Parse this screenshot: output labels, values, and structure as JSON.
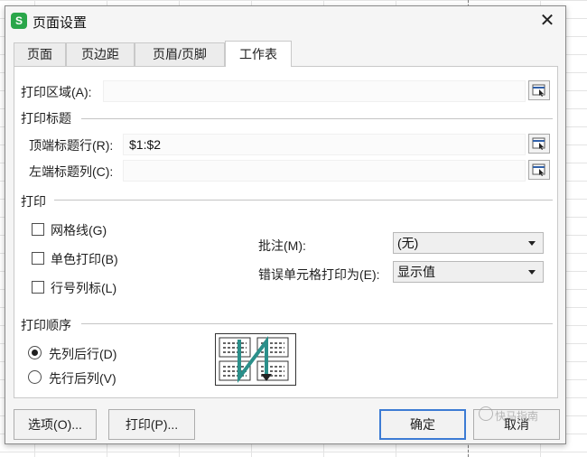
{
  "dialog": {
    "title": "页面设置",
    "app_icon_letter": "S",
    "close_glyph": "✕"
  },
  "tabs": [
    {
      "label": "页面",
      "active": false
    },
    {
      "label": "页边距",
      "active": false
    },
    {
      "label": "页眉/页脚",
      "active": false
    },
    {
      "label": "工作表",
      "active": true
    }
  ],
  "print_area": {
    "label": "打印区域(A):",
    "value": ""
  },
  "print_titles": {
    "section": "打印标题",
    "top_rows": {
      "label": "顶端标题行(R):",
      "value": "$1:$2"
    },
    "left_cols": {
      "label": "左端标题列(C):",
      "value": ""
    }
  },
  "print": {
    "section": "打印",
    "gridlines": {
      "label": "网格线(G)",
      "checked": false
    },
    "black_white": {
      "label": "单色打印(B)",
      "checked": false
    },
    "headings": {
      "label": "行号列标(L)",
      "checked": false
    },
    "comments": {
      "label": "批注(M):",
      "value": "(无)"
    },
    "cell_errors": {
      "label": "错误单元格打印为(E):",
      "value": "显示值"
    }
  },
  "page_order": {
    "section": "打印顺序",
    "down_then_over": {
      "label": "先列后行(D)",
      "checked": true
    },
    "over_then_down": {
      "label": "先行后列(V)",
      "checked": false
    }
  },
  "buttons": {
    "options": "选项(O)...",
    "print": "打印(P)...",
    "ok": "确定",
    "cancel": "取消"
  },
  "watermark": "快马指南",
  "colors": {
    "accent_border": "#3c7bd4",
    "app_icon": "#2aa64a",
    "order_arrow": "#2a8f8a"
  }
}
